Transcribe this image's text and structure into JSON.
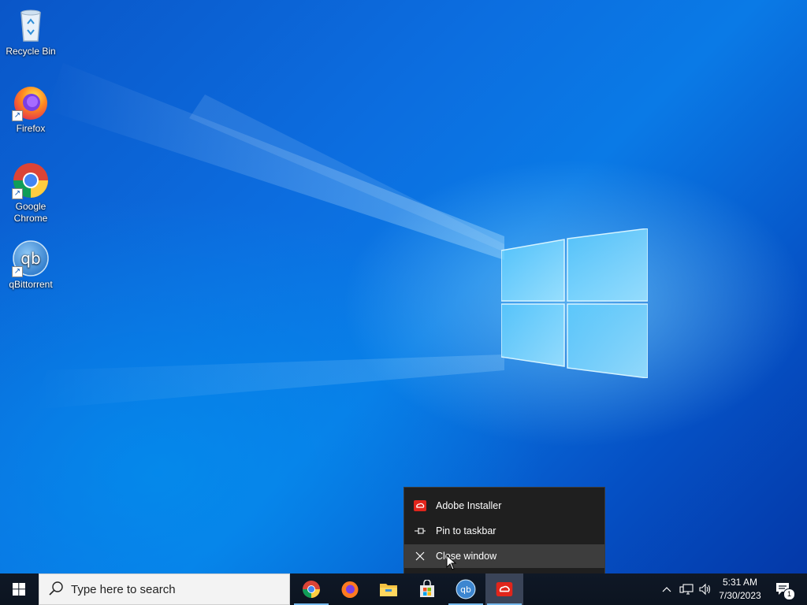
{
  "desktop": {
    "icons": [
      {
        "label": "Recycle Bin",
        "icon": "recycle-bin-icon"
      },
      {
        "label": "Firefox",
        "icon": "firefox-icon"
      },
      {
        "label": "Google Chrome",
        "icon": "chrome-icon"
      },
      {
        "label": "qBittorrent",
        "icon": "qbittorrent-icon"
      }
    ]
  },
  "jumplist": {
    "app_title": "Adobe Installer",
    "pin_label": "Pin to taskbar",
    "close_label": "Close window"
  },
  "taskbar": {
    "search_placeholder": "Type here to search",
    "apps": [
      {
        "name": "Google Chrome",
        "icon": "chrome-icon"
      },
      {
        "name": "Firefox",
        "icon": "firefox-icon"
      },
      {
        "name": "File Explorer",
        "icon": "file-explorer-icon"
      },
      {
        "name": "Microsoft Store",
        "icon": "store-icon"
      },
      {
        "name": "qBittorrent",
        "icon": "qbittorrent-icon"
      },
      {
        "name": "Adobe Installer",
        "icon": "adobe-creative-cloud-icon"
      }
    ],
    "clock": {
      "time": "5:31 AM",
      "date": "7/30/2023"
    },
    "notification_count": "1"
  },
  "colors": {
    "accent": "#0078d7",
    "adobe_red": "#e1251b",
    "taskbar": "#0f1826"
  }
}
